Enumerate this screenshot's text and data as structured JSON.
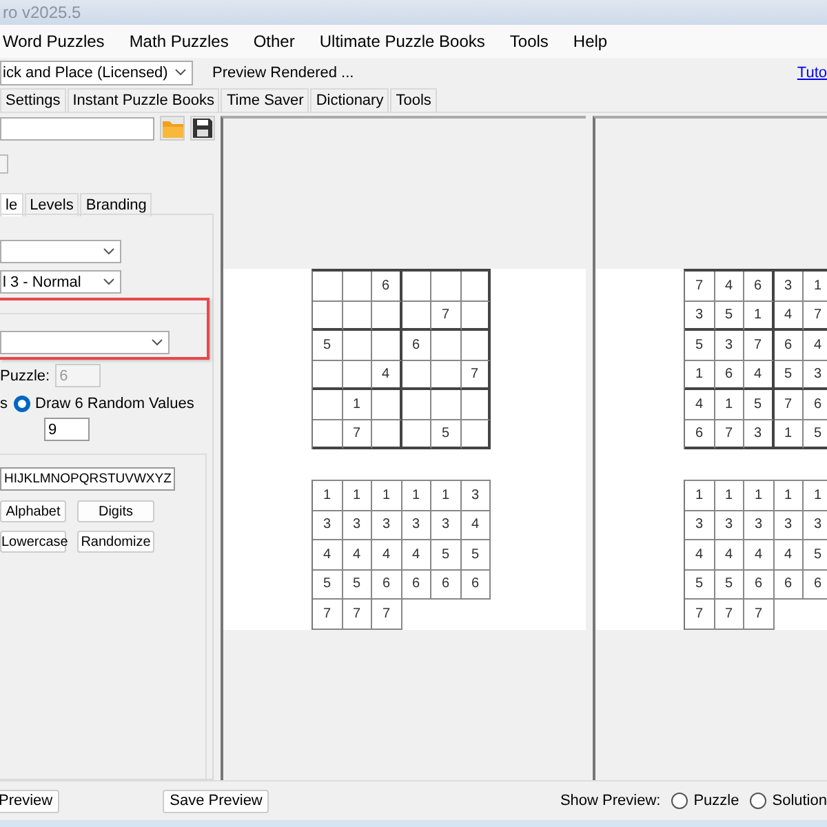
{
  "window": {
    "title": "ro v2025.5"
  },
  "menu": [
    "Word Puzzles",
    "Math Puzzles",
    "Other",
    "Ultimate Puzzle Books",
    "Tools",
    "Help"
  ],
  "toolbar": {
    "product_select": "ick and Place (Licensed)",
    "status": "Preview Rendered ...",
    "link": "Tuto"
  },
  "tabs": [
    {
      "label": "Settings",
      "selected": false
    },
    {
      "label": "Instant Puzzle Books",
      "selected": false
    },
    {
      "label": "Time Saver",
      "selected": false
    },
    {
      "label": "Dictionary",
      "selected": false
    },
    {
      "label": "Tools",
      "selected": false
    }
  ],
  "sub_tabs": [
    {
      "label": "le",
      "selected": true
    },
    {
      "label": "Levels",
      "selected": false
    },
    {
      "label": "Branding",
      "selected": false
    }
  ],
  "settings": {
    "level_select": "l 3 - Normal",
    "highlighted_group": {
      "highlighted": true
    },
    "puzzle_label": "Puzzle:",
    "puzzle_spinner": {
      "value": "6",
      "disabled": true
    },
    "radio_cut_label": "s",
    "random_radio": {
      "label": "Draw 6 Random Values",
      "selected": true
    },
    "count_spinner": {
      "value": "9",
      "disabled": false
    },
    "characters": "HIJKLMNOPQRSTUVWXYZ",
    "buttons": [
      "Alphabet",
      "Digits",
      "Lowercase",
      "Randomize"
    ]
  },
  "previews": [
    {
      "puzzle": [
        [
          {
            "blank": true
          },
          {
            "blank": true
          },
          {
            "value": "6"
          },
          {
            "blank": true
          },
          {
            "blank": true
          },
          {
            "blank": true
          }
        ],
        [
          {
            "blank": true
          },
          {
            "blank": true
          },
          {
            "blank": true
          },
          {
            "blank": true
          },
          {
            "value": "7"
          },
          {
            "blank": true
          }
        ],
        [
          {
            "value": "5"
          },
          {
            "blank": true
          },
          {
            "blank": true
          },
          {
            "value": "6"
          },
          {
            "blank": true
          },
          {
            "blank": true
          }
        ],
        [
          {
            "blank": true
          },
          {
            "blank": true
          },
          {
            "value": "4"
          },
          {
            "blank": true
          },
          {
            "blank": true
          },
          {
            "value": "7"
          }
        ],
        [
          {
            "blank": true
          },
          {
            "value": "1"
          },
          {
            "blank": true
          },
          {
            "blank": true
          },
          {
            "blank": true
          },
          {
            "blank": true
          }
        ],
        [
          {
            "blank": true
          },
          {
            "value": "7"
          },
          {
            "blank": true
          },
          {
            "blank": true
          },
          {
            "value": "5"
          },
          {
            "blank": true
          }
        ]
      ],
      "key": [
        [
          {
            "value": "1"
          },
          {
            "value": "1"
          },
          {
            "value": "1"
          },
          {
            "value": "1"
          },
          {
            "value": "1"
          },
          {
            "value": "3"
          }
        ],
        [
          {
            "value": "3"
          },
          {
            "value": "3"
          },
          {
            "value": "3"
          },
          {
            "value": "3"
          },
          {
            "value": "3"
          },
          {
            "value": "4"
          }
        ],
        [
          {
            "value": "4"
          },
          {
            "value": "4"
          },
          {
            "value": "4"
          },
          {
            "value": "4"
          },
          {
            "value": "5"
          },
          {
            "value": "5"
          }
        ],
        [
          {
            "value": "5"
          },
          {
            "value": "5"
          },
          {
            "value": "6"
          },
          {
            "value": "6"
          },
          {
            "value": "6"
          },
          {
            "value": "6"
          }
        ],
        [
          {
            "value": "7"
          },
          {
            "value": "7"
          },
          {
            "value": "7"
          }
        ]
      ]
    },
    {
      "puzzle": [
        [
          {
            "value": "7"
          },
          {
            "value": "4"
          },
          {
            "value": "6"
          },
          {
            "value": "3"
          },
          {
            "value": "1"
          }
        ],
        [
          {
            "value": "3"
          },
          {
            "value": "5"
          },
          {
            "value": "1"
          },
          {
            "value": "4"
          },
          {
            "value": "7"
          }
        ],
        [
          {
            "value": "5"
          },
          {
            "value": "3"
          },
          {
            "value": "7"
          },
          {
            "value": "6"
          },
          {
            "value": "4"
          }
        ],
        [
          {
            "value": "1"
          },
          {
            "value": "6"
          },
          {
            "value": "4"
          },
          {
            "value": "5"
          },
          {
            "value": "3"
          }
        ],
        [
          {
            "value": "4"
          },
          {
            "value": "1"
          },
          {
            "value": "5"
          },
          {
            "value": "7"
          },
          {
            "value": "6"
          }
        ],
        [
          {
            "value": "6"
          },
          {
            "value": "7"
          },
          {
            "value": "3"
          },
          {
            "value": "1"
          },
          {
            "value": "5"
          }
        ]
      ],
      "key": [
        [
          {
            "value": "1"
          },
          {
            "value": "1"
          },
          {
            "value": "1"
          },
          {
            "value": "1"
          },
          {
            "value": "1"
          }
        ],
        [
          {
            "value": "3"
          },
          {
            "value": "3"
          },
          {
            "value": "3"
          },
          {
            "value": "3"
          },
          {
            "value": "3"
          }
        ],
        [
          {
            "value": "4"
          },
          {
            "value": "4"
          },
          {
            "value": "4"
          },
          {
            "value": "4"
          },
          {
            "value": "5"
          }
        ],
        [
          {
            "value": "5"
          },
          {
            "value": "5"
          },
          {
            "value": "6"
          },
          {
            "value": "6"
          },
          {
            "value": "6"
          }
        ],
        [
          {
            "value": "7"
          },
          {
            "value": "7"
          },
          {
            "value": "7"
          }
        ]
      ]
    }
  ],
  "bottom": {
    "buttons": [
      "Preview",
      "Save Preview"
    ],
    "show_label": "Show Preview:",
    "radios": [
      {
        "label": "Puzzle",
        "selected": false
      },
      {
        "label": "Solution",
        "selected": false
      }
    ]
  }
}
